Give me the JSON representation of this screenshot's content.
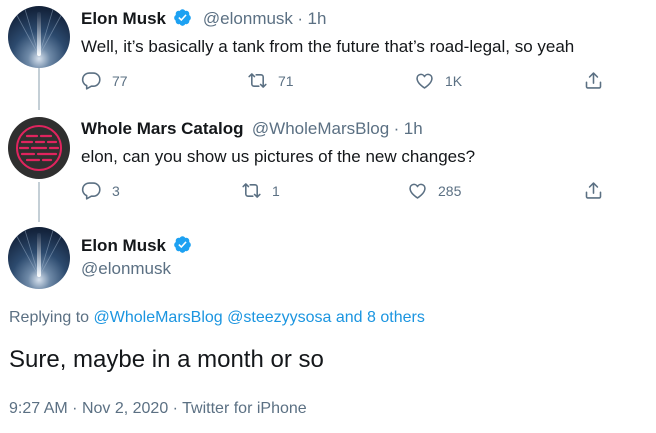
{
  "tweets": [
    {
      "name": "Elon Musk",
      "handle": "@elonmusk",
      "separator": "·",
      "time": "1h",
      "text": "Well, it’s basically a tank from the future that’s road-legal, so yeah",
      "replies": "77",
      "retweets": "71",
      "likes": "1K"
    },
    {
      "name": "Whole Mars Catalog",
      "handle": "@WholeMarsBlog",
      "separator": "·",
      "time": "1h",
      "text": "elon, can you show us pictures of the new changes?",
      "replies": "3",
      "retweets": "1",
      "likes": "285"
    }
  ],
  "main_tweet": {
    "name": "Elon Musk",
    "handle": "@elonmusk",
    "replying_prefix": "Replying to",
    "replying_to": [
      "@WholeMarsBlog",
      "@steezyysosa",
      "and 8 others"
    ],
    "text": "Sure, maybe in a month or so",
    "time": "9:27 AM",
    "separator": "·",
    "date": "Nov 2, 2020",
    "separator2": "·",
    "source": "Twitter for iPhone"
  },
  "colors": {
    "verified": "#1da1f2",
    "link": "#1b95e0",
    "secondary_text": "#5b7083",
    "avatar_wmc_accent": "#e0245e"
  },
  "icons": [
    "reply-icon",
    "retweet-icon",
    "like-icon",
    "share-icon",
    "verified-badge-icon"
  ]
}
